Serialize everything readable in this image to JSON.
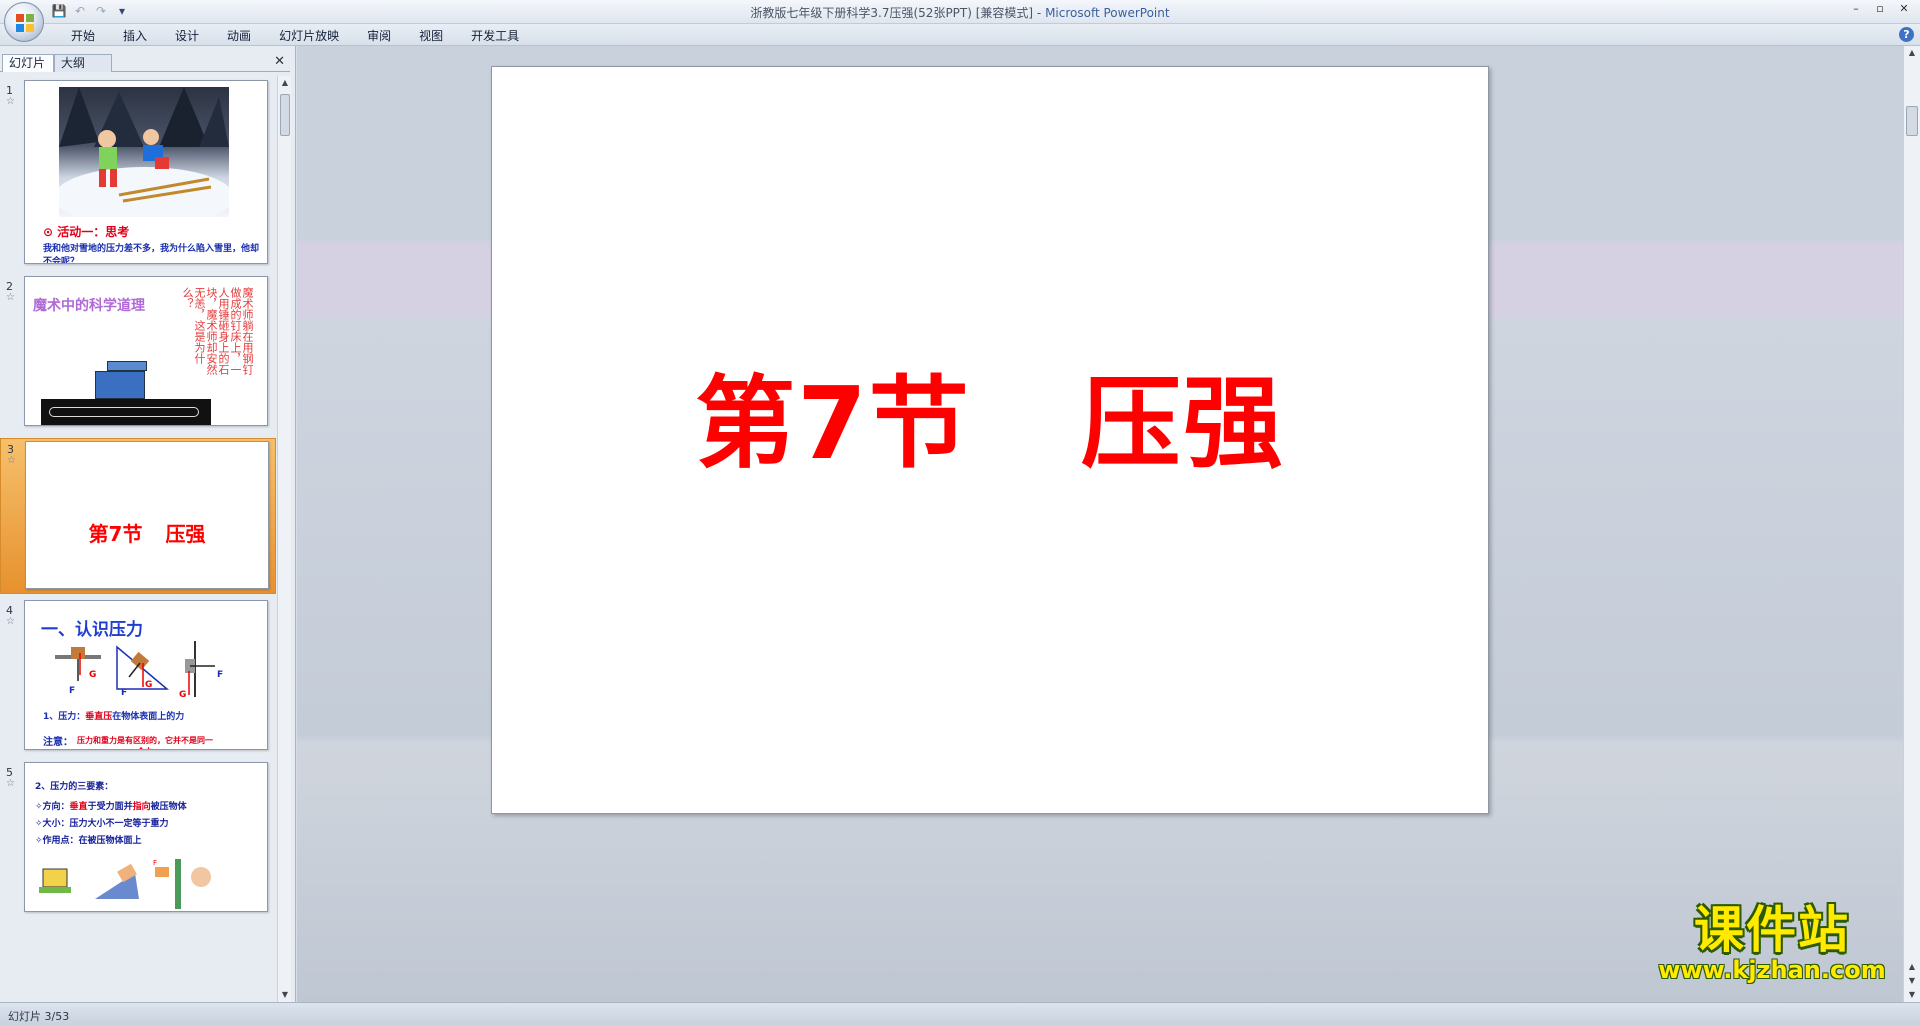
{
  "window": {
    "title": "浙教版七年级下册科学3.7压强(52张PPT) [兼容模式]",
    "separator": " - ",
    "app_name": "Microsoft PowerPoint",
    "controls": [
      "–",
      "▫",
      "✕"
    ]
  },
  "quick_access": {
    "save": "💾",
    "undo": "↶",
    "redo": "↷",
    "more": "▾"
  },
  "ribbon": {
    "tabs": [
      "开始",
      "插入",
      "设计",
      "动画",
      "幻灯片放映",
      "审阅",
      "视图",
      "开发工具"
    ],
    "help": "?"
  },
  "pane": {
    "tabs": {
      "slides": "幻灯片",
      "outline": "大纲"
    },
    "close": "✕"
  },
  "thumbnails": [
    {
      "num": "1",
      "title_line": "⊙ 活动一：思考",
      "body_line": "我和他对雪地的压力差不多，我为什么陷入雪里，他却不会呢？"
    },
    {
      "num": "2",
      "title": "魔术中的科学道理",
      "vertical_text": "魔术师躺在用钢钉做成的钉床上，一人用锤砸身上的石块，魔术师却安然无恙，这是为什么？"
    },
    {
      "num": "3",
      "title_left": "第7节",
      "title_right": "压强",
      "selected": true
    },
    {
      "num": "4",
      "title": "一、认识压力",
      "line1_prefix": "1、压力：",
      "line1_red": "垂直压",
      "line1_suffix": "在物体表面上的力",
      "note_label": "注意：",
      "note_text": "压力和重力是有区别的，它并不是同一个力"
    },
    {
      "num": "5",
      "heading": "2、压力的三要素：",
      "dir_label": "✧方向：",
      "dir_red": "垂直",
      "dir_mid": "于受力面并",
      "dir_red2": "指向",
      "dir_tail": "被压物体",
      "size_label": "✧大小：",
      "size_text": "压力大小不一定等于重力",
      "point_label": "✧作用点：",
      "point_text": "在被压物体面上"
    }
  ],
  "slide": {
    "title_left": "第7节",
    "title_right": "压强"
  },
  "watermark": {
    "cn": "课件站",
    "url": "www.kjzhan.com"
  },
  "status": {
    "slide_indicator": "幻灯片 3/53"
  },
  "colors": {
    "title_red": "#ff0000",
    "selection_orange": "#e7912e",
    "watermark_yellow": "#ffea00"
  }
}
